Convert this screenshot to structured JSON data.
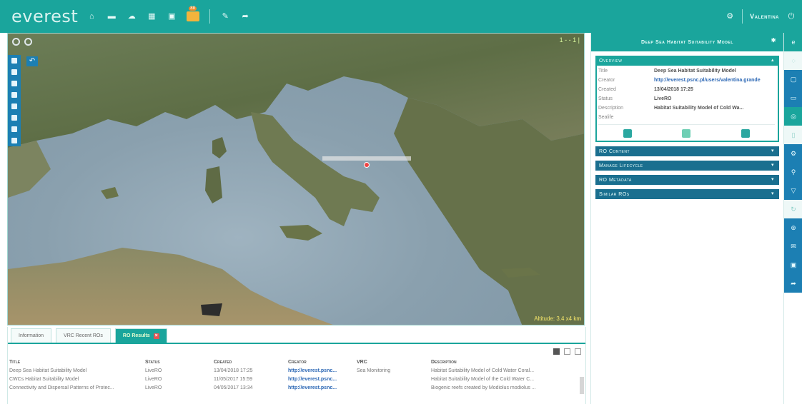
{
  "app": {
    "logo": "everest",
    "username": "Valentina",
    "notification_count": "88"
  },
  "top_icons": [
    "home-icon",
    "layers-icon",
    "cloud-icon",
    "grid-icon",
    "calendar-icon",
    "chat-icon",
    "edit-icon",
    "share-icon"
  ],
  "map": {
    "altitude": "Altitude: 3.4 x4 km",
    "scale": "1 - - 1 |",
    "pin_label": ""
  },
  "bottom": {
    "tabs": [
      {
        "label": "Information"
      },
      {
        "label": "VRC Recent ROs"
      },
      {
        "label": "RO Results"
      }
    ],
    "columns": [
      "Title",
      "Status",
      "Created",
      "Creator",
      "VRC",
      "Description"
    ],
    "rows": [
      {
        "title": "Deep Sea Habitat Suitability Model",
        "status": "LiveRO",
        "created": "13/04/2018 17:25",
        "creator": "http://everest.psnc...",
        "vrc": "Sea Monitoring",
        "description": "Habitat Suitability Model of Cold Water Coral..."
      },
      {
        "title": "CWCs Habitat Suitability Model",
        "status": "LiveRO",
        "created": "11/05/2017 15:59",
        "creator": "http://everest.psnc...",
        "vrc": "",
        "description": "Habitat Suitability Model of the Cold Water C..."
      },
      {
        "title": "Connectivity and Dispersal Patterns of Protec...",
        "status": "LiveRO",
        "created": "04/05/2017 13:34",
        "creator": "http://everest.psnc...",
        "vrc": "",
        "description": "Biogenic reefs created by Modiolus modiolus ..."
      }
    ]
  },
  "panel": {
    "title": "Deep Sea Habitat Suitability Model",
    "overview_label": "Overview",
    "fields": [
      {
        "key": "Title",
        "value": "Deep Sea Habitat Suitability Model",
        "link": false
      },
      {
        "key": "Creator",
        "value": "http://everest.psnc.pl/users/valentina.grande",
        "link": true
      },
      {
        "key": "Created",
        "value": "13/04/2018 17:25",
        "link": false
      },
      {
        "key": "Status",
        "value": "LiveRO",
        "link": false
      },
      {
        "key": "Description",
        "value": "Habitat Suitability Model of Cold Wa...",
        "link": false
      },
      {
        "key": "Sealife",
        "value": "",
        "link": false
      }
    ],
    "sections": [
      "RO Content",
      "Manage Lifecycle",
      "RO Metadata",
      "Similar ROs"
    ]
  },
  "colors": {
    "teal": "#1aa59c",
    "blue": "#1c7fb3",
    "link": "#2a66b4"
  }
}
